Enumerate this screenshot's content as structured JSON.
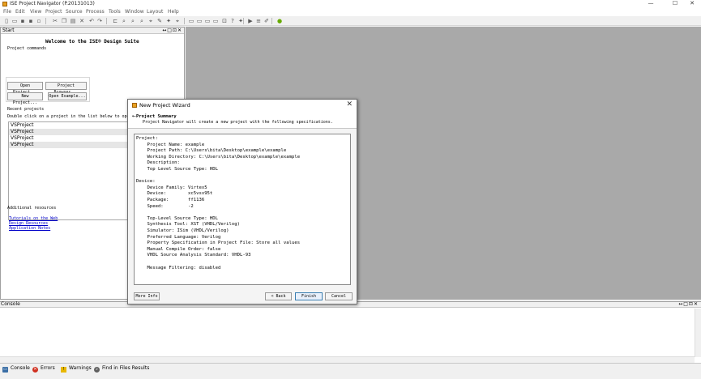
{
  "window": {
    "title": "ISE Project Navigator (P.20131013)",
    "controls": {
      "minimize": "—",
      "maximize": "☐",
      "close": "✕"
    }
  },
  "menu": [
    "File",
    "Edit",
    "View",
    "Project",
    "Source",
    "Process",
    "Tools",
    "Window",
    "Layout",
    "Help"
  ],
  "start_pane": {
    "title": "Start",
    "controls": "↔□⊡✕",
    "welcome": "Welcome to the ISE® Design Suite",
    "project_commands_label": "Project commands",
    "buttons": {
      "open_project": "Open Project...",
      "project_browser": "Project Browser...",
      "new_project": "New Project...",
      "open_example": "Open Example..."
    },
    "recent_projects_label": "Recent projects",
    "recent_hint": "Double click on a project in the list below to open",
    "recent_projects": [
      "VSProject",
      "VSProject",
      "VSProject",
      "VSProject"
    ],
    "additional_resources_label": "Additional resources",
    "links": [
      "Tutorials on the Web",
      "Design Resources",
      "Application Notes"
    ]
  },
  "dialog": {
    "title": "New Project Wizard",
    "close": "✕",
    "header_arrow": "←",
    "header_title": "Project Summary",
    "header_subtitle": "Project Navigator will create a new project with the following specifications.",
    "summary_lines": [
      "Project:",
      "    Project Name: example",
      "    Project Path: C:\\Users\\bita\\Desktop\\example\\example",
      "    Working Directory: C:\\Users\\bita\\Desktop\\example\\example",
      "    Description:",
      "    Top Level Source Type: HDL",
      "",
      "Device:",
      "    Device Family: Virtex5",
      "    Device:        xc5vsx95t",
      "    Package:       ff1136",
      "    Speed:         -2",
      "",
      "    Top-Level Source Type: HDL",
      "    Synthesis Tool: XST (VHDL/Verilog)",
      "    Simulator: ISim (VHDL/Verilog)",
      "    Preferred Language: Verilog",
      "    Property Specification in Project File: Store all values",
      "    Manual Compile Order: false",
      "    VHDL Source Analysis Standard: VHDL-93",
      "",
      "    Message Filtering: disabled"
    ],
    "buttons": {
      "more_info": "More Info",
      "back": "< Back",
      "finish": "Finish",
      "cancel": "Cancel"
    }
  },
  "console": {
    "title": "Console",
    "controls": "↔□⊡✕"
  },
  "status_tabs": [
    {
      "label": "Console",
      "icon": "console-icon",
      "color": "#3a6ea5"
    },
    {
      "label": "Errors",
      "icon": "error-icon",
      "color": "#d03020"
    },
    {
      "label": "Warnings",
      "icon": "warning-icon",
      "color": "#e8b800"
    },
    {
      "label": "Find in Files Results",
      "icon": "find-icon",
      "color": "#606060"
    }
  ],
  "colors": {
    "workspace": "#a9a9a9",
    "link": "#0000c8"
  }
}
